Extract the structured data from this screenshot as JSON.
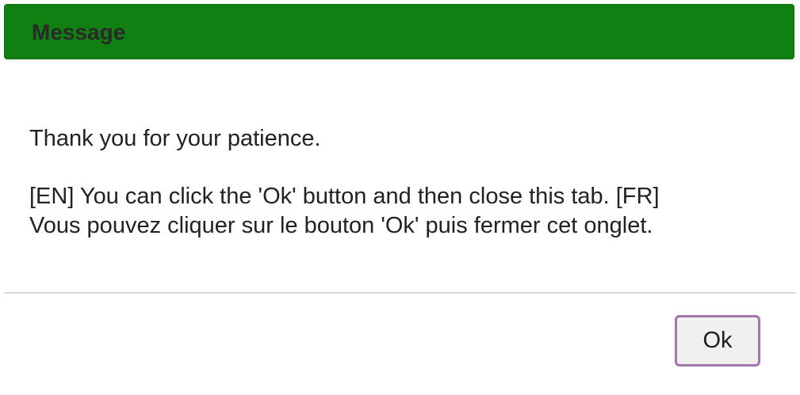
{
  "dialog": {
    "title": "Message",
    "body_line1": "Thank you for your patience.",
    "body_en": "[EN] You can click the 'Ok' button and then close this tab. [FR]",
    "body_fr": "Vous pouvez cliquer sur le bouton 'Ok' puis fermer cet onglet.",
    "ok_label": "Ok"
  },
  "colors": {
    "titlebar": "#108013",
    "button_border": "#a476ad",
    "divider": "#dcdcdc"
  }
}
